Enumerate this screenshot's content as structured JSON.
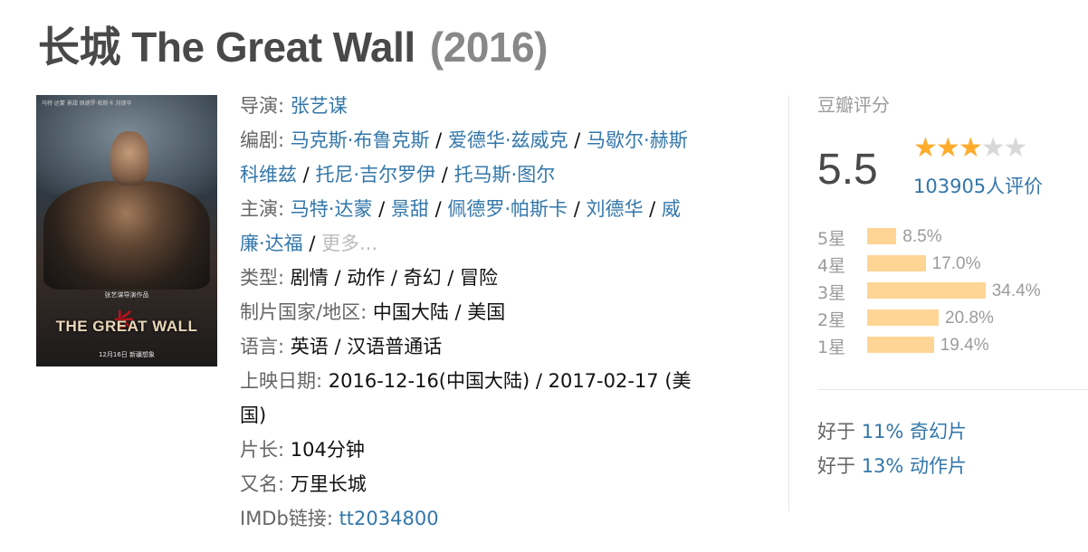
{
  "title": {
    "main": "长城 The Great Wall",
    "year": "(2016)"
  },
  "poster": {
    "top_line": "马特·达蒙  景甜  佩德罗·帕斯卡  刘德华",
    "credit": "张艺谋导演作品",
    "title_text": "THE GREAT WALL",
    "release_text": "12月16日 新疆想象",
    "seal_char": "长城"
  },
  "info": {
    "director": {
      "label": "导演",
      "names": [
        "张艺谋"
      ]
    },
    "writers": {
      "label": "编剧",
      "names": [
        "马克斯·布鲁克斯",
        "爱德华·兹威克",
        "马歇尔·赫斯科维兹",
        "托尼·吉尔罗伊",
        "托马斯·图尔"
      ]
    },
    "cast": {
      "label": "主演",
      "names": [
        "马特·达蒙",
        "景甜",
        "佩德罗·帕斯卡",
        "刘德华",
        "威廉·达福"
      ],
      "more": "更多..."
    },
    "genre": {
      "label": "类型",
      "value": "剧情 / 动作 / 奇幻 / 冒险"
    },
    "country": {
      "label": "制片国家/地区",
      "value": "中国大陆 / 美国"
    },
    "language": {
      "label": "语言",
      "value": "英语 / 汉语普通话"
    },
    "release": {
      "label": "上映日期",
      "value": "2016-12-16(中国大陆) / 2017-02-17 (美国)"
    },
    "runtime": {
      "label": "片长",
      "value": "104分钟"
    },
    "aka": {
      "label": "又名",
      "value": "万里长城"
    },
    "imdb": {
      "label": "IMDb链接",
      "value": "tt2034800"
    }
  },
  "rating": {
    "heading": "豆瓣评分",
    "score": "5.5",
    "stars_value": 3,
    "stars_max": 5,
    "votes": "103905人评价",
    "star_color": "#ffac2d",
    "bar_color": "#ffd596",
    "distribution": [
      {
        "label": "5星",
        "percent": 8.5,
        "text": "8.5%"
      },
      {
        "label": "4星",
        "percent": 17.0,
        "text": "17.0%"
      },
      {
        "label": "3星",
        "percent": 34.4,
        "text": "34.4%"
      },
      {
        "label": "2星",
        "percent": 20.8,
        "text": "20.8%"
      },
      {
        "label": "1星",
        "percent": 19.4,
        "text": "19.4%"
      }
    ]
  },
  "better_than": [
    {
      "prefix": "好于",
      "link": "11% 奇幻片"
    },
    {
      "prefix": "好于",
      "link": "13% 动作片"
    }
  ],
  "link_color": "#3377aa"
}
